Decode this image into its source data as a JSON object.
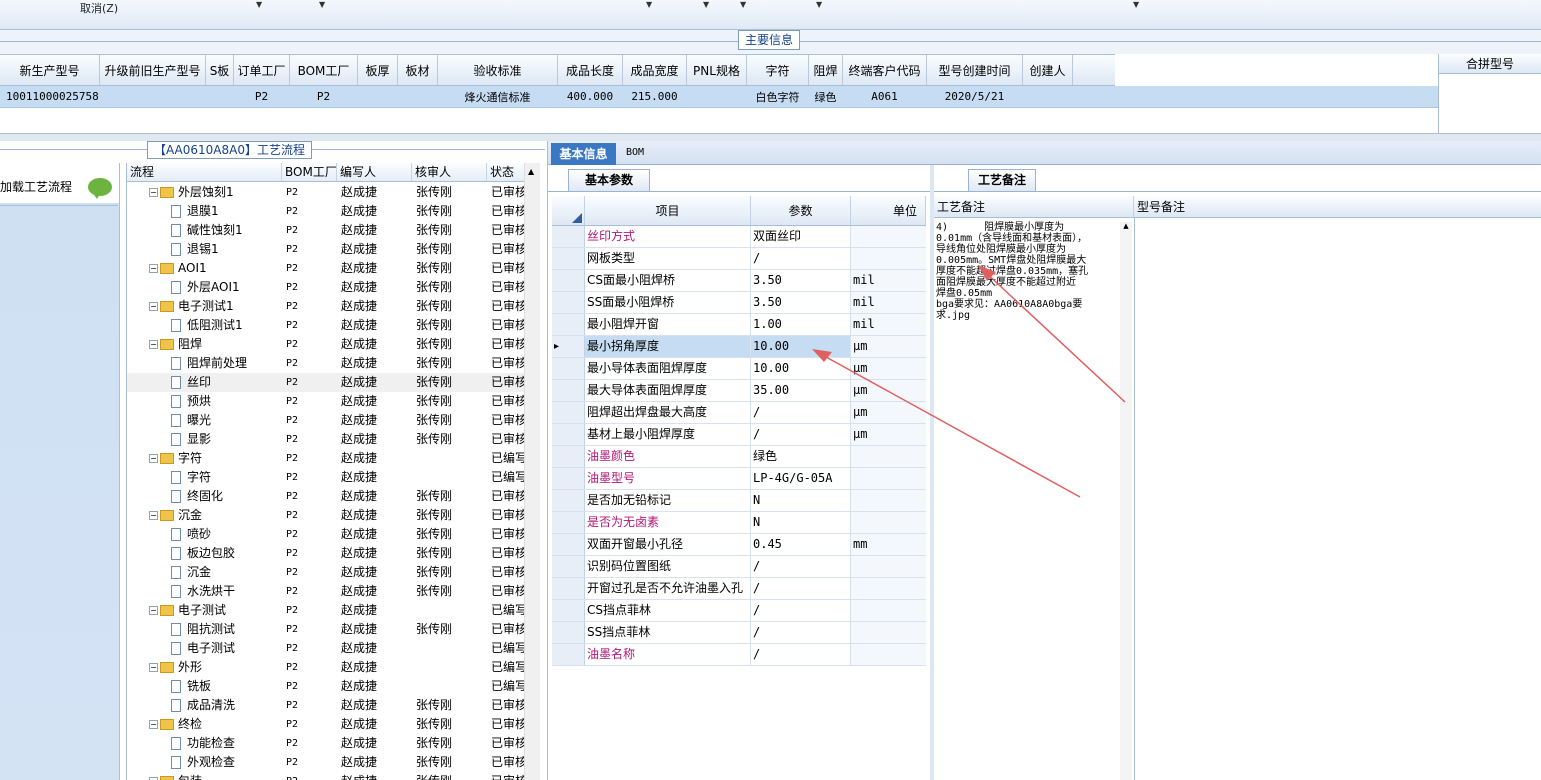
{
  "toolbar": {
    "cancel_label": "取消(Z)"
  },
  "main_group_title": "主要信息",
  "main_headers": [
    "新生产型号",
    "升级前旧生产型号",
    "S板",
    "订单工厂",
    "BOM工厂",
    "板厚",
    "板材",
    "验收标准",
    "成品长度",
    "成品宽度",
    "PNL规格",
    "字符",
    "阻焊",
    "终端客户代码",
    "型号创建时间",
    "创建人"
  ],
  "main_row": [
    "10011000025758",
    "",
    "",
    "P2",
    "P2",
    "",
    "",
    "烽火通信标准",
    "400.000",
    "215.000",
    "",
    "白色字符",
    "绿色",
    "A061",
    "2020/5/21",
    ""
  ],
  "merge_header": "合拼型号",
  "left_title": "【AA0610A8A0】工艺流程",
  "load_label": "加载工艺流程",
  "tree_headers": [
    "流程",
    "BOM工厂",
    "编写人",
    "核审人",
    "状态"
  ],
  "tree_rows": [
    {
      "level": 0,
      "name": "外层蚀刻1",
      "bom": "P2",
      "writer": "赵成捷",
      "reviewer": "张传刚",
      "status": "已审核"
    },
    {
      "level": 1,
      "name": "退膜1",
      "bom": "P2",
      "writer": "赵成捷",
      "reviewer": "张传刚",
      "status": "已审核"
    },
    {
      "level": 1,
      "name": "碱性蚀刻1",
      "bom": "P2",
      "writer": "赵成捷",
      "reviewer": "张传刚",
      "status": "已审核"
    },
    {
      "level": 1,
      "name": "退锡1",
      "bom": "P2",
      "writer": "赵成捷",
      "reviewer": "张传刚",
      "status": "已审核"
    },
    {
      "level": 0,
      "name": "AOI1",
      "bom": "P2",
      "writer": "赵成捷",
      "reviewer": "张传刚",
      "status": "已审核"
    },
    {
      "level": 1,
      "name": "外层AOI1",
      "bom": "P2",
      "writer": "赵成捷",
      "reviewer": "张传刚",
      "status": "已审核"
    },
    {
      "level": 0,
      "name": "电子测试1",
      "bom": "P2",
      "writer": "赵成捷",
      "reviewer": "张传刚",
      "status": "已审核"
    },
    {
      "level": 1,
      "name": "低阻测试1",
      "bom": "P2",
      "writer": "赵成捷",
      "reviewer": "张传刚",
      "status": "已审核"
    },
    {
      "level": 0,
      "name": "阻焊",
      "bom": "P2",
      "writer": "赵成捷",
      "reviewer": "张传刚",
      "status": "已审核"
    },
    {
      "level": 1,
      "name": "阻焊前处理",
      "bom": "P2",
      "writer": "赵成捷",
      "reviewer": "张传刚",
      "status": "已审核"
    },
    {
      "level": 1,
      "name": "丝印",
      "bom": "P2",
      "writer": "赵成捷",
      "reviewer": "张传刚",
      "status": "已审核",
      "selected": true
    },
    {
      "level": 1,
      "name": "预烘",
      "bom": "P2",
      "writer": "赵成捷",
      "reviewer": "张传刚",
      "status": "已审核"
    },
    {
      "level": 1,
      "name": "曝光",
      "bom": "P2",
      "writer": "赵成捷",
      "reviewer": "张传刚",
      "status": "已审核"
    },
    {
      "level": 1,
      "name": "显影",
      "bom": "P2",
      "writer": "赵成捷",
      "reviewer": "张传刚",
      "status": "已审核"
    },
    {
      "level": 0,
      "name": "字符",
      "bom": "P2",
      "writer": "赵成捷",
      "reviewer": "",
      "status": "已编写"
    },
    {
      "level": 1,
      "name": "字符",
      "bom": "P2",
      "writer": "赵成捷",
      "reviewer": "",
      "status": "已编写"
    },
    {
      "level": 1,
      "name": "终固化",
      "bom": "P2",
      "writer": "赵成捷",
      "reviewer": "张传刚",
      "status": "已审核"
    },
    {
      "level": 0,
      "name": "沉金",
      "bom": "P2",
      "writer": "赵成捷",
      "reviewer": "张传刚",
      "status": "已审核"
    },
    {
      "level": 1,
      "name": "喷砂",
      "bom": "P2",
      "writer": "赵成捷",
      "reviewer": "张传刚",
      "status": "已审核"
    },
    {
      "level": 1,
      "name": "板边包胶",
      "bom": "P2",
      "writer": "赵成捷",
      "reviewer": "张传刚",
      "status": "已审核"
    },
    {
      "level": 1,
      "name": "沉金",
      "bom": "P2",
      "writer": "赵成捷",
      "reviewer": "张传刚",
      "status": "已审核"
    },
    {
      "level": 1,
      "name": "水洗烘干",
      "bom": "P2",
      "writer": "赵成捷",
      "reviewer": "张传刚",
      "status": "已审核"
    },
    {
      "level": 0,
      "name": "电子测试",
      "bom": "P2",
      "writer": "赵成捷",
      "reviewer": "",
      "status": "已编写"
    },
    {
      "level": 1,
      "name": "阻抗测试",
      "bom": "P2",
      "writer": "赵成捷",
      "reviewer": "张传刚",
      "status": "已审核"
    },
    {
      "level": 1,
      "name": "电子测试",
      "bom": "P2",
      "writer": "赵成捷",
      "reviewer": "",
      "status": "已编写"
    },
    {
      "level": 0,
      "name": "外形",
      "bom": "P2",
      "writer": "赵成捷",
      "reviewer": "",
      "status": "已编写"
    },
    {
      "level": 1,
      "name": "铣板",
      "bom": "P2",
      "writer": "赵成捷",
      "reviewer": "",
      "status": "已编写"
    },
    {
      "level": 1,
      "name": "成品清洗",
      "bom": "P2",
      "writer": "赵成捷",
      "reviewer": "张传刚",
      "status": "已审核"
    },
    {
      "level": 0,
      "name": "终检",
      "bom": "P2",
      "writer": "赵成捷",
      "reviewer": "张传刚",
      "status": "已审核"
    },
    {
      "level": 1,
      "name": "功能检查",
      "bom": "P2",
      "writer": "赵成捷",
      "reviewer": "张传刚",
      "status": "已审核"
    },
    {
      "level": 1,
      "name": "外观检查",
      "bom": "P2",
      "writer": "赵成捷",
      "reviewer": "张传刚",
      "status": "已审核"
    },
    {
      "level": 0,
      "name": "包装",
      "bom": "P2",
      "writer": "赵成捷",
      "reviewer": "张传刚",
      "status": "已审核"
    }
  ],
  "tabs": {
    "basic": "基本信息",
    "bom": "BOM"
  },
  "param_tab": "基本参数",
  "param_headers": [
    "项目",
    "参数",
    "单位"
  ],
  "params": [
    {
      "name": "丝印方式",
      "value": "双面丝印",
      "unit": "",
      "pink": true
    },
    {
      "name": "网板类型",
      "value": "/",
      "unit": ""
    },
    {
      "name": "CS面最小阻焊桥",
      "value": "3.50",
      "unit": "mil"
    },
    {
      "name": "SS面最小阻焊桥",
      "value": "3.50",
      "unit": "mil"
    },
    {
      "name": "最小阻焊开窗",
      "value": "1.00",
      "unit": "mil"
    },
    {
      "name": "最小拐角厚度",
      "value": "10.00",
      "unit": "μm",
      "current": true
    },
    {
      "name": "最小导体表面阻焊厚度",
      "value": "10.00",
      "unit": "μm"
    },
    {
      "name": "最大导体表面阻焊厚度",
      "value": "35.00",
      "unit": "μm"
    },
    {
      "name": "阻焊超出焊盘最大高度",
      "value": "/",
      "unit": "μm"
    },
    {
      "name": "基材上最小阻焊厚度",
      "value": "/",
      "unit": "μm"
    },
    {
      "name": "油墨颜色",
      "value": "绿色",
      "unit": "",
      "pink": true
    },
    {
      "name": "油墨型号",
      "value": "LP-4G/G-05A",
      "unit": "",
      "pink": true
    },
    {
      "name": "是否加无铅标记",
      "value": "N",
      "unit": ""
    },
    {
      "name": "是否为无卤素",
      "value": "N",
      "unit": "",
      "pink": true
    },
    {
      "name": "双面开窗最小孔径",
      "value": "0.45",
      "unit": "mm"
    },
    {
      "name": "识别码位置图纸",
      "value": "/",
      "unit": ""
    },
    {
      "name": "开窗过孔是否不允许油墨入孔",
      "value": "/",
      "unit": ""
    },
    {
      "name": "CS挡点菲林",
      "value": "/",
      "unit": ""
    },
    {
      "name": "SS挡点菲林",
      "value": "/",
      "unit": ""
    },
    {
      "name": "油墨名称",
      "value": "/",
      "unit": "",
      "pink": true
    }
  ],
  "remarks_tab": "工艺备注",
  "remarks_headers": [
    "工艺备注",
    "型号备注"
  ],
  "process_remark": "4)      阻焊膜最小厚度为\n0.01mm（含导线面和基材表面），\n导线角位处阻焊膜最小厚度为\n0.005mm。SMT焊盘处阻焊膜最大\n厚度不能超过焊盘0.035mm，塞孔\n面阻焊膜最大厚度不能超过附近\n焊盘0.05mm\nbga要求见：AA0610A8A0bga要\n求.jpg"
}
